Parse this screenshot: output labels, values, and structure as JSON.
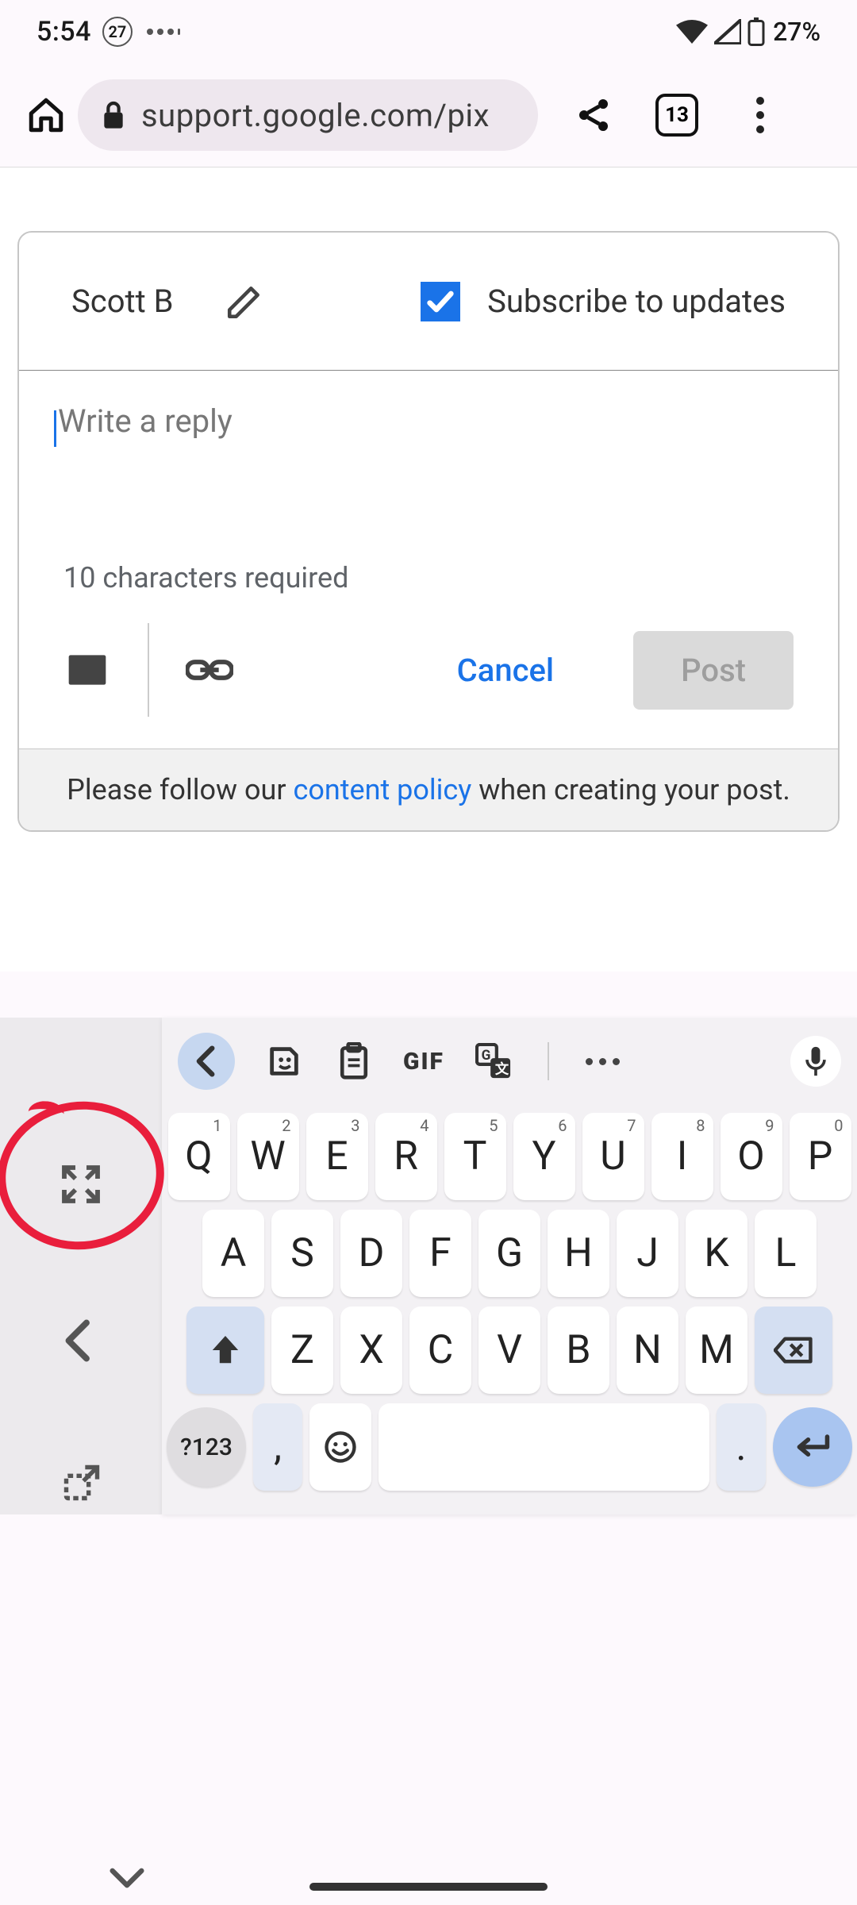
{
  "status": {
    "time": "5:54",
    "notif_count": "27",
    "battery": "27%"
  },
  "browser": {
    "url": "support.google.com/pix",
    "tab_count": "13"
  },
  "reply": {
    "author": "Scott B",
    "subscribe_label": "Subscribe to updates",
    "placeholder": "Write a reply",
    "requirement": "10 characters required",
    "cancel": "Cancel",
    "post": "Post",
    "policy_pre": "Please follow our ",
    "policy_link": "content policy",
    "policy_post": " when creating your post."
  },
  "keyboard": {
    "gif": "GIF",
    "row1": [
      {
        "k": "Q",
        "s": "1"
      },
      {
        "k": "W",
        "s": "2"
      },
      {
        "k": "E",
        "s": "3"
      },
      {
        "k": "R",
        "s": "4"
      },
      {
        "k": "T",
        "s": "5"
      },
      {
        "k": "Y",
        "s": "6"
      },
      {
        "k": "U",
        "s": "7"
      },
      {
        "k": "I",
        "s": "8"
      },
      {
        "k": "O",
        "s": "9"
      },
      {
        "k": "P",
        "s": "0"
      }
    ],
    "row2": [
      "A",
      "S",
      "D",
      "F",
      "G",
      "H",
      "J",
      "K",
      "L"
    ],
    "row3": [
      "Z",
      "X",
      "C",
      "V",
      "B",
      "N",
      "M"
    ],
    "sym": "?123",
    "comma": ",",
    "dot": "."
  }
}
